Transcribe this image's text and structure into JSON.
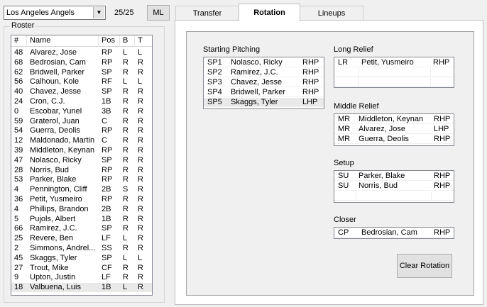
{
  "team_select": {
    "value": "Los Angeles Angels"
  },
  "roster_count": "25/25",
  "ml_button": "ML",
  "roster": {
    "legend": "Roster",
    "columns": {
      "num": "#",
      "name": "Name",
      "pos": "Pos",
      "bats": "B",
      "throws": "T"
    },
    "rows": [
      {
        "num": "48",
        "name": "Alvarez, Jose",
        "pos": "RP",
        "b": "L",
        "t": "L"
      },
      {
        "num": "68",
        "name": "Bedrosian, Cam",
        "pos": "RP",
        "b": "R",
        "t": "R"
      },
      {
        "num": "62",
        "name": "Bridwell, Parker",
        "pos": "SP",
        "b": "R",
        "t": "R"
      },
      {
        "num": "56",
        "name": "Calhoun, Kole",
        "pos": "RF",
        "b": "L",
        "t": "L"
      },
      {
        "num": "40",
        "name": "Chavez, Jesse",
        "pos": "SP",
        "b": "R",
        "t": "R"
      },
      {
        "num": "24",
        "name": "Cron, C.J.",
        "pos": "1B",
        "b": "R",
        "t": "R"
      },
      {
        "num": "0",
        "name": "Escobar, Yunel",
        "pos": "3B",
        "b": "R",
        "t": "R"
      },
      {
        "num": "59",
        "name": "Graterol, Juan",
        "pos": "C",
        "b": "R",
        "t": "R"
      },
      {
        "num": "54",
        "name": "Guerra, Deolis",
        "pos": "RP",
        "b": "R",
        "t": "R"
      },
      {
        "num": "12",
        "name": "Maldonado, Martin",
        "pos": "C",
        "b": "R",
        "t": "R"
      },
      {
        "num": "39",
        "name": "Middleton, Keynan",
        "pos": "RP",
        "b": "R",
        "t": "R"
      },
      {
        "num": "47",
        "name": "Nolasco, Ricky",
        "pos": "SP",
        "b": "R",
        "t": "R"
      },
      {
        "num": "28",
        "name": "Norris, Bud",
        "pos": "RP",
        "b": "R",
        "t": "R"
      },
      {
        "num": "53",
        "name": "Parker, Blake",
        "pos": "RP",
        "b": "R",
        "t": "R"
      },
      {
        "num": "4",
        "name": "Pennington, Cliff",
        "pos": "2B",
        "b": "S",
        "t": "R"
      },
      {
        "num": "36",
        "name": "Petit, Yusmeiro",
        "pos": "RP",
        "b": "R",
        "t": "R"
      },
      {
        "num": "4",
        "name": "Phillips, Brandon",
        "pos": "2B",
        "b": "R",
        "t": "R"
      },
      {
        "num": "5",
        "name": "Pujols, Albert",
        "pos": "1B",
        "b": "R",
        "t": "R"
      },
      {
        "num": "66",
        "name": "Ramirez, J.C.",
        "pos": "SP",
        "b": "R",
        "t": "R"
      },
      {
        "num": "25",
        "name": "Revere, Ben",
        "pos": "LF",
        "b": "L",
        "t": "R"
      },
      {
        "num": "2",
        "name": "Simmons, Andrel...",
        "pos": "SS",
        "b": "R",
        "t": "R"
      },
      {
        "num": "45",
        "name": "Skaggs, Tyler",
        "pos": "SP",
        "b": "L",
        "t": "L"
      },
      {
        "num": "27",
        "name": "Trout, Mike",
        "pos": "CF",
        "b": "R",
        "t": "R"
      },
      {
        "num": "9",
        "name": "Upton, Justin",
        "pos": "LF",
        "b": "R",
        "t": "R"
      },
      {
        "num": "18",
        "name": "Valbuena, Luis",
        "pos": "1B",
        "b": "L",
        "t": "R"
      }
    ]
  },
  "tabs": [
    {
      "label": "Transfer"
    },
    {
      "label": "Rotation"
    },
    {
      "label": "Lineups"
    }
  ],
  "rotation": {
    "starting": {
      "label": "Starting Pitching",
      "rows": [
        {
          "slot": "SP1",
          "name": "Nolasco, Ricky",
          "hand": "RHP"
        },
        {
          "slot": "SP2",
          "name": "Ramirez, J.C.",
          "hand": "RHP"
        },
        {
          "slot": "SP3",
          "name": "Chavez, Jesse",
          "hand": "RHP"
        },
        {
          "slot": "SP4",
          "name": "Bridwell, Parker",
          "hand": "RHP"
        },
        {
          "slot": "SP5",
          "name": "Skaggs, Tyler",
          "hand": "LHP"
        }
      ]
    },
    "long_relief": {
      "label": "Long Relief",
      "rows": [
        {
          "slot": "LR",
          "name": "Petit, Yusmeiro",
          "hand": "RHP"
        }
      ]
    },
    "middle_relief": {
      "label": "Middle Relief",
      "rows": [
        {
          "slot": "MR",
          "name": "Middleton, Keynan",
          "hand": "RHP"
        },
        {
          "slot": "MR",
          "name": "Alvarez, Jose",
          "hand": "LHP"
        },
        {
          "slot": "MR",
          "name": "Guerra, Deolis",
          "hand": "RHP"
        }
      ]
    },
    "setup": {
      "label": "Setup",
      "rows": [
        {
          "slot": "SU",
          "name": "Parker, Blake",
          "hand": "RHP"
        },
        {
          "slot": "SU",
          "name": "Norris, Bud",
          "hand": "RHP"
        }
      ]
    },
    "closer": {
      "label": "Closer",
      "rows": [
        {
          "slot": "CP",
          "name": "Bedrosian, Cam",
          "hand": "RHP"
        }
      ]
    },
    "clear_button": "Clear Rotation"
  }
}
